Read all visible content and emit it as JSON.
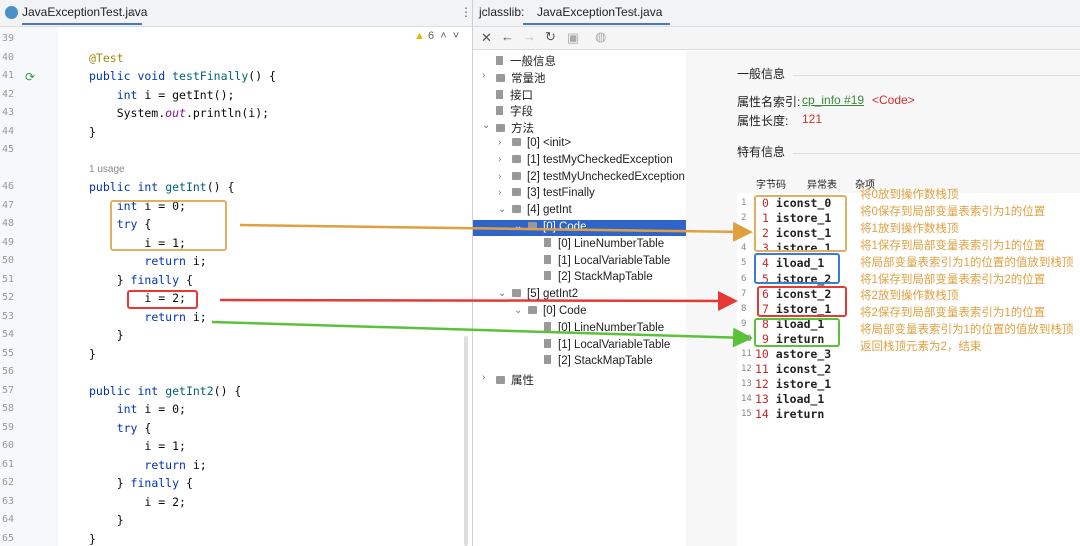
{
  "editor": {
    "tab": "JavaExceptionTest.java",
    "warnings": "6",
    "usage": "1 usage",
    "lines": [
      {
        "n": "39",
        "html": ""
      },
      {
        "n": "40",
        "html": "<span class='an'>@Test</span>"
      },
      {
        "n": "41",
        "html": "<span class='kw'>public void</span> <span class='fn'>testFinally</span>() {"
      },
      {
        "n": "42",
        "html": "    <span class='kw'>int</span> i = getInt();"
      },
      {
        "n": "43",
        "html": "    System.<span class='it'>out</span>.println(i);"
      },
      {
        "n": "44",
        "html": "}"
      },
      {
        "n": "45",
        "html": ""
      },
      {
        "n": "46",
        "html": "<span class='kw'>public int</span> <span class='fn'>getInt</span>() {"
      },
      {
        "n": "47",
        "html": "    <span class='kw'>int</span> i = 0;"
      },
      {
        "n": "48",
        "html": "    <span class='kw'>try</span> {"
      },
      {
        "n": "49",
        "html": "        i = 1;"
      },
      {
        "n": "50",
        "html": "        <span class='kw'>return</span> i;"
      },
      {
        "n": "51",
        "html": "    } <span class='kw'>finally</span> {"
      },
      {
        "n": "52",
        "html": "        i = 2;"
      },
      {
        "n": "53",
        "html": "        <span class='kw'>return</span> i;"
      },
      {
        "n": "54",
        "html": "    }"
      },
      {
        "n": "55",
        "html": "}"
      },
      {
        "n": "56",
        "html": ""
      },
      {
        "n": "57",
        "html": "<span class='kw'>public int</span> <span class='fn'>getInt2</span>() {"
      },
      {
        "n": "58",
        "html": "    <span class='kw'>int</span> i = 0;"
      },
      {
        "n": "59",
        "html": "    <span class='kw'>try</span> {"
      },
      {
        "n": "60",
        "html": "        i = 1;"
      },
      {
        "n": "61",
        "html": "        <span class='kw'>return</span> i;"
      },
      {
        "n": "62",
        "html": "    } <span class='kw'>finally</span> {"
      },
      {
        "n": "63",
        "html": "        i = 2;"
      },
      {
        "n": "64",
        "html": "    }"
      },
      {
        "n": "65",
        "html": "}"
      }
    ]
  },
  "jclasslib": {
    "label": "jclasslib:",
    "tab": "JavaExceptionTest.java",
    "tree": [
      {
        "t": "一般信息",
        "lvl": 0,
        "icon": "doc"
      },
      {
        "t": "常量池",
        "lvl": 0,
        "icon": "folder",
        "exp": ">"
      },
      {
        "t": "接口",
        "lvl": 0,
        "icon": "doc"
      },
      {
        "t": "字段",
        "lvl": 0,
        "icon": "doc"
      },
      {
        "t": "方法",
        "lvl": 0,
        "icon": "folder",
        "exp": "v"
      },
      {
        "t": "[0] <init>",
        "lvl": 1,
        "icon": "folder",
        "exp": ">"
      },
      {
        "t": "[1] testMyCheckedException",
        "lvl": 1,
        "icon": "folder",
        "exp": ">"
      },
      {
        "t": "[2] testMyUncheckedException",
        "lvl": 1,
        "icon": "folder",
        "exp": ">"
      },
      {
        "t": "[3] testFinally",
        "lvl": 1,
        "icon": "folder",
        "exp": ">"
      },
      {
        "t": "[4] getInt",
        "lvl": 1,
        "icon": "folder",
        "exp": "v"
      },
      {
        "t": "[0] Code",
        "lvl": 2,
        "icon": "folder",
        "exp": "v",
        "sel": true
      },
      {
        "t": "[0] LineNumberTable",
        "lvl": 3,
        "icon": "doc"
      },
      {
        "t": "[1] LocalVariableTable",
        "lvl": 3,
        "icon": "doc"
      },
      {
        "t": "[2] StackMapTable",
        "lvl": 3,
        "icon": "doc"
      },
      {
        "t": "[5] getInt2",
        "lvl": 1,
        "icon": "folder",
        "exp": "v"
      },
      {
        "t": "[0] Code",
        "lvl": 2,
        "icon": "folder",
        "exp": "v"
      },
      {
        "t": "[0] LineNumberTable",
        "lvl": 3,
        "icon": "doc"
      },
      {
        "t": "[1] LocalVariableTable",
        "lvl": 3,
        "icon": "doc"
      },
      {
        "t": "[2] StackMapTable",
        "lvl": 3,
        "icon": "doc"
      },
      {
        "t": "属性",
        "lvl": 0,
        "icon": "folder",
        "exp": ">"
      }
    ],
    "general_title": "一般信息",
    "attr_name_label": "属性名索引:",
    "attr_name_link": "cp_info #19",
    "attr_name_value": "<Code>",
    "attr_len_label": "属性长度:",
    "attr_len_value": "121",
    "specific_title": "特有信息",
    "subtabs": [
      "字节码",
      "异常表",
      "杂项"
    ],
    "bytecode": [
      [
        "0",
        "iconst_0"
      ],
      [
        "1",
        "istore_1"
      ],
      [
        "2",
        "iconst_1"
      ],
      [
        "3",
        "istore_1"
      ],
      [
        "4",
        "iload_1"
      ],
      [
        "5",
        "istore_2"
      ],
      [
        "6",
        "iconst_2"
      ],
      [
        "7",
        "istore_1"
      ],
      [
        "8",
        "iload_1"
      ],
      [
        "9",
        "ireturn"
      ],
      [
        "10",
        "astore_3"
      ],
      [
        "11",
        "iconst_2"
      ],
      [
        "12",
        "istore_1"
      ],
      [
        "13",
        "iload_1"
      ],
      [
        "14",
        "ireturn"
      ]
    ],
    "comments": [
      "将0放到操作数栈顶",
      "将0保存到局部变量表索引为1的位置",
      "将1放到操作数栈顶",
      "将1保存到局部变量表索引为1的位置",
      "将局部变量表索引为1的位置的值放到栈顶",
      "将1保存到局部变量表索引为2的位置",
      "将2放到操作数栈顶",
      "将2保存到局部变量表索引为1的位置",
      "将局部变量表索引为1的位置的值放到栈顶",
      "返回栈顶元素为2，结束"
    ]
  },
  "colors": {
    "orange": "#e0a040",
    "blue": "#3a7bd5",
    "red": "#e53935",
    "green": "#5ac23a",
    "selection": "#2f65ca"
  }
}
